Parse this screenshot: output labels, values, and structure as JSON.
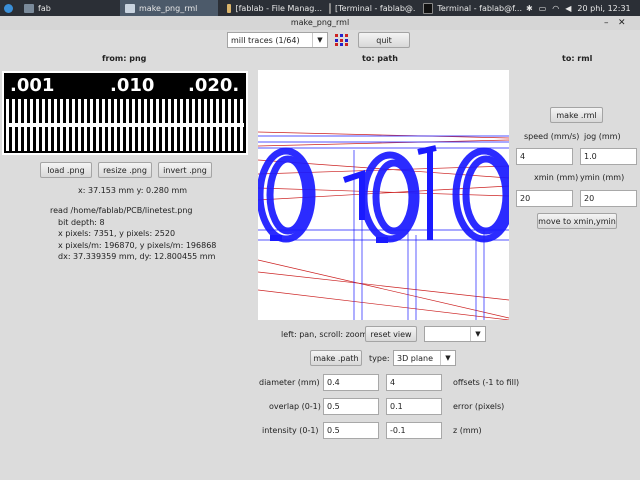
{
  "taskbar": {
    "workspace": "fab",
    "tasks": [
      {
        "label": "make_png_rml",
        "active": true
      },
      {
        "label": "[fablab - File Manag...",
        "active": false
      },
      {
        "label": "[Terminal - fablab@...",
        "active": false
      },
      {
        "label": "Terminal - fablab@f...",
        "active": false
      }
    ],
    "date": "20 phi, 12:31"
  },
  "window": {
    "title": "make_png_rml"
  },
  "toolbar": {
    "process_select": "mill traces (1/64)",
    "quit_label": "quit"
  },
  "from_panel": {
    "header": "from: png",
    "preview_labels": [
      ".001",
      ".010",
      ".020."
    ],
    "load_label": "load .png",
    "resize_label": "resize .png",
    "invert_label": "invert .png",
    "size_readout": "x: 37.153 mm  y: 0.280 mm",
    "info_lines": [
      "read /home/fablab/PCB/linetest.png",
      "bit depth: 8",
      "x pixels: 7351, y pixels: 2520",
      "x pixels/m: 196870, y pixels/m: 196868",
      "dx: 37.339359 mm, dy: 12.800455 mm"
    ]
  },
  "path_panel": {
    "header": "to: path",
    "view_hint": "left: pan, scroll: zoom",
    "reset_view_label": "reset view",
    "view_select": "",
    "make_path_label": "make .path",
    "type_label": "type:",
    "type_value": "3D plane",
    "diameter_label": "diameter (mm)",
    "diameter_value": "0.4",
    "offsets_value": "4",
    "offsets_label": "offsets (-1 to fill)",
    "overlap_label": "overlap (0-1)",
    "overlap_value": "0.5",
    "error_value": "0.1",
    "error_label": "error (pixels)",
    "intensity_label": "intensity (0-1)",
    "intensity_value": "0.5",
    "z_value": "-0.1",
    "z_label": "z (mm)"
  },
  "rml_panel": {
    "header": "to: rml",
    "make_rml_label": "make .rml",
    "speed_label": "speed (mm/s)",
    "speed_value": "4",
    "jog_label": "jog (mm)",
    "jog_value": "1.0",
    "xmin_label": "xmin (mm)",
    "xmin_value": "20",
    "ymin_label": "ymin (mm)",
    "ymin_value": "20",
    "move_label": "move to xmin,ymin"
  },
  "colors": {
    "path_blue": "#1a1aff",
    "path_red": "#cc2222",
    "taskbar": "#2b2f36"
  }
}
